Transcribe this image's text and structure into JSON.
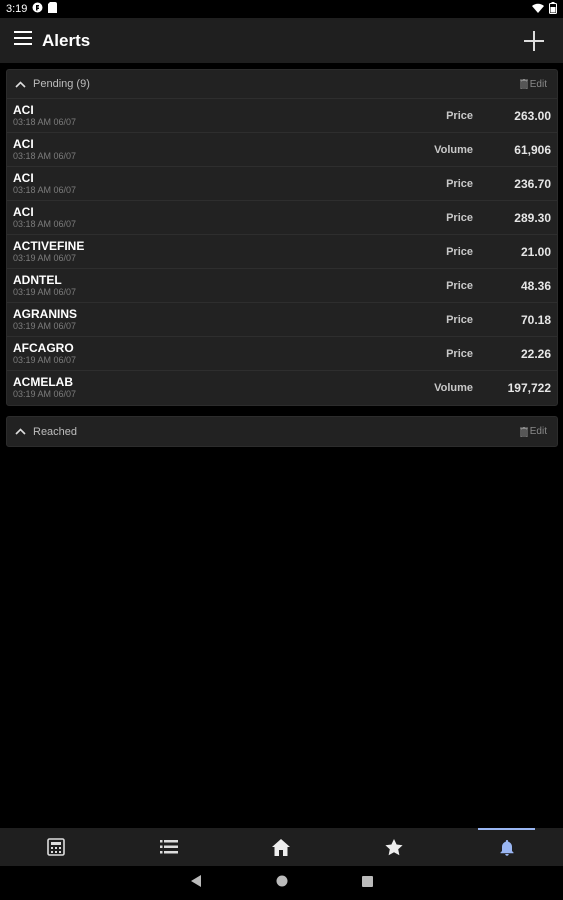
{
  "status_bar": {
    "time": "3:19"
  },
  "app_bar": {
    "title": "Alerts"
  },
  "pending": {
    "title": "Pending (9)",
    "edit_label": "Edit",
    "items": [
      {
        "symbol": "ACI",
        "time": "03:18 AM 06/07",
        "type": "Price",
        "value": "263.00"
      },
      {
        "symbol": "ACI",
        "time": "03:18 AM 06/07",
        "type": "Volume",
        "value": "61,906"
      },
      {
        "symbol": "ACI",
        "time": "03:18 AM 06/07",
        "type": "Price",
        "value": "236.70"
      },
      {
        "symbol": "ACI",
        "time": "03:18 AM 06/07",
        "type": "Price",
        "value": "289.30"
      },
      {
        "symbol": "ACTIVEFINE",
        "time": "03:19 AM 06/07",
        "type": "Price",
        "value": "21.00"
      },
      {
        "symbol": "ADNTEL",
        "time": "03:19 AM 06/07",
        "type": "Price",
        "value": "48.36"
      },
      {
        "symbol": "AGRANINS",
        "time": "03:19 AM 06/07",
        "type": "Price",
        "value": "70.18"
      },
      {
        "symbol": "AFCAGRO",
        "time": "03:19 AM 06/07",
        "type": "Price",
        "value": "22.26"
      },
      {
        "symbol": "ACMELAB",
        "time": "03:19 AM 06/07",
        "type": "Volume",
        "value": "197,722"
      }
    ]
  },
  "reached": {
    "title": "Reached",
    "edit_label": "Edit"
  },
  "bottom_nav": {
    "items": [
      {
        "icon": "calculator-icon",
        "active": false
      },
      {
        "icon": "list-icon",
        "active": false
      },
      {
        "icon": "home-icon",
        "active": false
      },
      {
        "icon": "star-icon",
        "active": false
      },
      {
        "icon": "bell-icon",
        "active": true
      }
    ],
    "active_color": "#9ab6f2"
  },
  "colors": {
    "background": "#000000",
    "surface": "#222222",
    "app_bar": "#1f1f1f",
    "accent": "#9ab6f2"
  }
}
